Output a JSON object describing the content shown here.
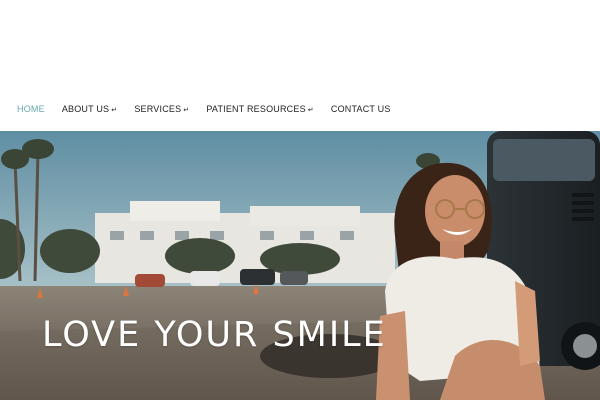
{
  "nav": {
    "items": [
      {
        "label": "HOME",
        "active": true,
        "has_submenu": false
      },
      {
        "label": "ABOUT US",
        "active": false,
        "has_submenu": true
      },
      {
        "label": "SERVICES",
        "active": false,
        "has_submenu": true
      },
      {
        "label": "PATIENT RESOURCES",
        "active": false,
        "has_submenu": true
      },
      {
        "label": "CONTACT US",
        "active": false,
        "has_submenu": false
      }
    ],
    "submenu_glyph": "↵"
  },
  "hero": {
    "headline": "LOVE YOUR SMILE",
    "image": "smiling-woman-sitting-on-street-photo"
  },
  "colors": {
    "accent": "#6aa7b0",
    "nav_text": "#222222",
    "headline": "#ffffff"
  }
}
